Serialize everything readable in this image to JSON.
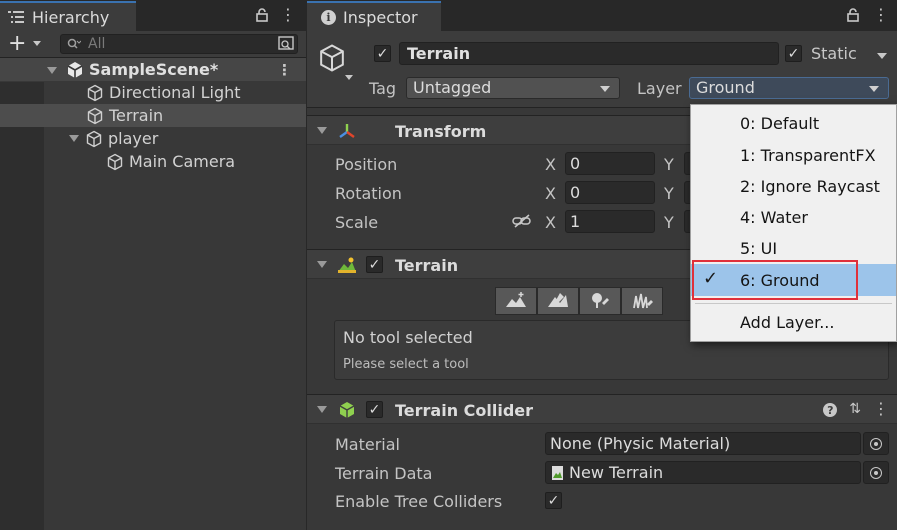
{
  "hierarchy": {
    "tab_title": "Hierarchy",
    "search_placeholder": "All",
    "items": [
      {
        "label": "SampleScene*",
        "depth": 0,
        "type": "scene"
      },
      {
        "label": "Directional Light",
        "depth": 1
      },
      {
        "label": "Terrain",
        "depth": 1,
        "selected": true
      },
      {
        "label": "player",
        "depth": 1
      },
      {
        "label": "Main Camera",
        "depth": 2
      }
    ]
  },
  "inspector": {
    "tab_title": "Inspector",
    "object": {
      "name": "Terrain",
      "static_label": "Static",
      "tag_label": "Tag",
      "tag_value": "Untagged",
      "layer_label": "Layer",
      "layer_value": "Ground"
    },
    "transform": {
      "title": "Transform",
      "rows": [
        {
          "label": "Position",
          "x": "0"
        },
        {
          "label": "Rotation",
          "x": "0"
        },
        {
          "label": "Scale",
          "x": "1"
        }
      ],
      "axis_x": "X",
      "axis_y": "Y"
    },
    "terrain": {
      "title": "Terrain",
      "tool_status": "No tool selected",
      "tool_hint": "Please select a tool"
    },
    "terrain_collider": {
      "title": "Terrain Collider",
      "rows": [
        {
          "label": "Material",
          "value": "None (Physic Material)"
        },
        {
          "label": "Terrain Data",
          "value": "New Terrain"
        },
        {
          "label": "Enable Tree Colliders",
          "checked": true
        }
      ]
    }
  },
  "layer_menu": {
    "items": [
      "0: Default",
      "1: TransparentFX",
      "2: Ignore Raycast",
      "4: Water",
      "5: UI",
      "6: Ground"
    ],
    "selected": "6: Ground",
    "add_layer": "Add Layer..."
  },
  "colors": {
    "accent": "#3a72b0",
    "highlight_box": "#e0303a",
    "menu_selected": "#9cc4ea"
  }
}
